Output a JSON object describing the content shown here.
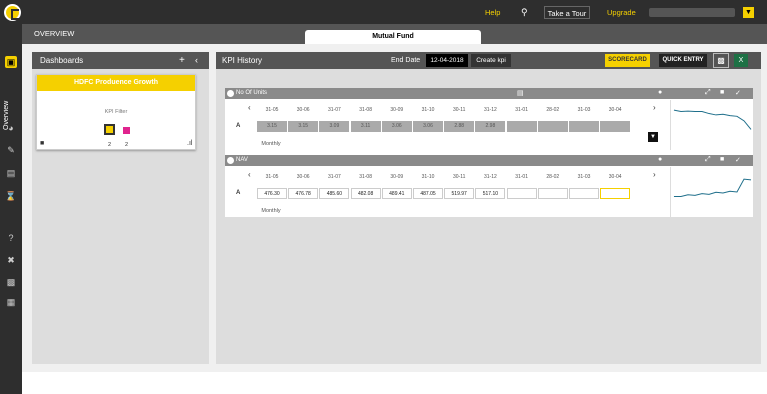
{
  "topbar": {
    "help": "Help",
    "search_icon": "search-icon",
    "tour": "Take a Tour",
    "upgrade": "Upgrade",
    "dropdown_icon": "chevron-down-icon"
  },
  "sidebar": {
    "overview_label": "Overview",
    "icons": [
      "dashboard-icon",
      "gauge-icon",
      "edit-icon",
      "document-icon",
      "hourglass-icon",
      "help-icon",
      "tools-icon",
      "chat-icon",
      "calendar-icon"
    ]
  },
  "subbar": {
    "title": "OVERVIEW",
    "tab": "Mutual Fund"
  },
  "dashboards": {
    "title": "Dashboards",
    "add": "+",
    "collapse": "‹",
    "card": {
      "title": "HDFC Produence Growth",
      "filter_label": "KPI Filter",
      "counts": [
        "2",
        "2"
      ],
      "swatches": [
        "#f5d000",
        "#e0248e"
      ]
    }
  },
  "kpi": {
    "title": "KPI History",
    "end_date_label": "End Date",
    "end_date": "12-04-2018",
    "create": "Create kpi",
    "scorecard": "SCORECARD",
    "quick_entry": "QUICK ENTRY"
  },
  "panels": [
    {
      "name": "No Of Units",
      "row": "A",
      "dates": [
        "31-05",
        "30-06",
        "31-07",
        "31-08",
        "30-09",
        "31-10",
        "30-11",
        "31-12",
        "31-01",
        "28-02",
        "31-03",
        "30-04"
      ],
      "values": [
        "3.15",
        "3.15",
        "3.09",
        "3.11",
        "3.06",
        "3.06",
        "2.88",
        "2.98",
        "",
        "",
        "",
        ""
      ],
      "spark": [
        0.86,
        0.82,
        0.83,
        0.82,
        0.82,
        0.76,
        0.72,
        0.74,
        0.7,
        0.68,
        0.55,
        0.3
      ],
      "spark_label": "Monthly"
    },
    {
      "name": "NAV",
      "row": "A",
      "dates": [
        "31-05",
        "30-06",
        "31-07",
        "31-08",
        "30-09",
        "31-10",
        "30-11",
        "31-12",
        "31-01",
        "28-02",
        "31-03",
        "30-04"
      ],
      "values": [
        "476.30",
        "476.78",
        "485.60",
        "482.08",
        "489.41",
        "487.05",
        "519.97",
        "517.10",
        "",
        "",
        "",
        ""
      ],
      "spark": [
        0.3,
        0.3,
        0.35,
        0.33,
        0.38,
        0.36,
        0.42,
        0.4,
        0.45,
        0.43,
        0.8,
        0.78
      ],
      "spark_label": "Monthly"
    }
  ]
}
